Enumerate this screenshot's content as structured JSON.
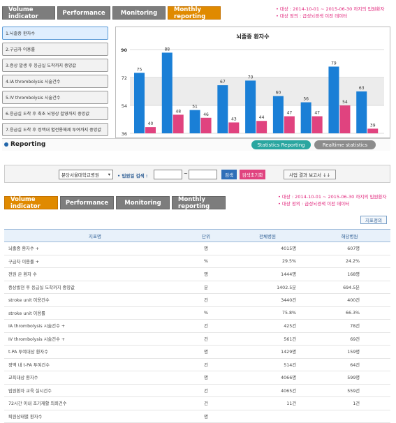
{
  "top_tabs": [
    "Volume indicator",
    "Performance",
    "Monitoring",
    "Monthly reporting"
  ],
  "top_notes": [
    "• 대상 : 2014-10-01 ~ 2015-06-30 까지의 입원환자",
    "• 대상 정의 : 급성뇌경색 이전 데이터"
  ],
  "menu_items": [
    "1.뇌졸중 환자수",
    "2.구급차 이용률",
    "3.증상 발생 후 응급실 도착까지 중앙값",
    "4.IA thrombolysis 시술건수",
    "5.IV thrombolysis 시술건수",
    "6.응급실 도착 후 최초 뇌영상 촬영까지 중앙값",
    "7.응급실 도착 후 정맥내 혈전용해제 투여까지 중앙값"
  ],
  "chart_data": {
    "type": "bar",
    "title": "뇌졸중 환자수",
    "ytick_labels": [
      "90",
      "72",
      "54",
      "36"
    ],
    "ylim": [
      36,
      90
    ],
    "series": [
      {
        "values": [
          75,
          88,
          51,
          67,
          70,
          60,
          56,
          79,
          63
        ],
        "color": "#1a7fd6"
      },
      {
        "values": [
          40,
          48,
          46,
          43,
          44,
          47,
          47,
          54,
          39
        ],
        "color": "#e0437f"
      }
    ]
  },
  "reporting": {
    "label": "Reporting",
    "stats_btn": "Statistics Reporting",
    "realtime_btn": "Realtime statistics"
  },
  "filter": {
    "hospital": "분당서울대학교병원",
    "date_label": "• 입원일 검색 :",
    "dash": "~",
    "search_btn": "검색",
    "reset_btn": "검색초기화",
    "report_btn": "사업 결과 보고서 ↓↓"
  },
  "bottom_tabs": [
    "Volume indicator",
    "Performance",
    "Monitoring",
    "Monthly reporting"
  ],
  "bottom_notes": [
    "• 대상 : 2014-10-01 ~ 2015-06-30 까지의 입원환자",
    "• 대상 정의 : 급성뇌경색 이전 데이터"
  ],
  "table_button": "지표정의",
  "table": {
    "headers": [
      "지표명",
      "단위",
      "전체병원",
      "해당병원"
    ],
    "rows": [
      [
        "뇌졸중 환자수 +",
        "명",
        "4015명",
        "607명"
      ],
      [
        "구급차 이용률 +",
        "%",
        "29.5%",
        "24.2%"
      ],
      [
        "전원 온 환자 수",
        "명",
        "1444명",
        "168명"
      ],
      [
        "증상발현 후 응급실 도착까지 중앙값",
        "분",
        "1402.5분",
        "694.5분"
      ],
      [
        "stroke unit 이용건수",
        "건",
        "3440건",
        "400건"
      ],
      [
        "stroke unit 이용률",
        "%",
        "75.8%",
        "66.3%"
      ],
      [
        "IA thrombolysis 시술건수 +",
        "건",
        "425건",
        "78건"
      ],
      [
        "IV thrombolysis 시술건수 +",
        "건",
        "561건",
        "69건"
      ],
      [
        "t-PA 투여대상 환자수",
        "명",
        "1429명",
        "159명"
      ],
      [
        "정맥 내 t-PA 투여건수",
        "건",
        "514건",
        "64건"
      ],
      [
        "교육대상 환자수",
        "명",
        "4066명",
        "599명"
      ],
      [
        "입원환자 교육 실시건수",
        "건",
        "4065건",
        "559건"
      ],
      [
        "72시간 이내 조기재활 의뢰건수",
        "건",
        "11건",
        "1건"
      ],
      [
        "퇴원상태별 환자수",
        "명",
        "",
        ""
      ]
    ]
  }
}
